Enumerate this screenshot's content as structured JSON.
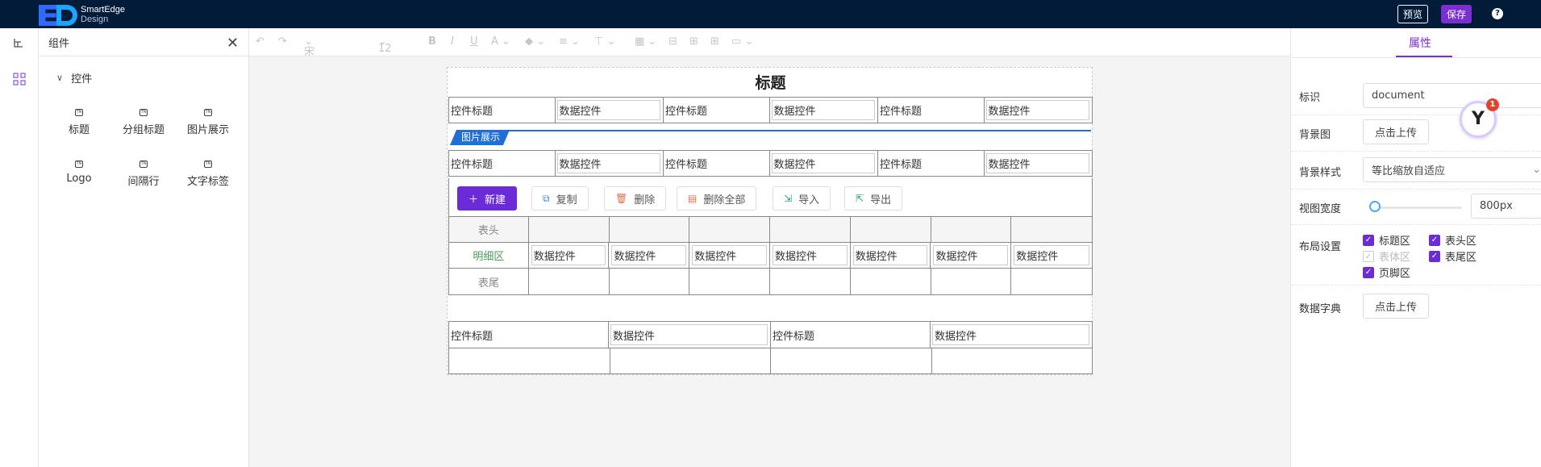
{
  "app": {
    "brand_line1": "SmartEdge",
    "brand_line2": "Design"
  },
  "header": {
    "preview_label": "预览",
    "save_label": "保存",
    "help_icon": "question-icon"
  },
  "left_panel": {
    "title": "组件",
    "group_title": "控件",
    "components": [
      {
        "label": "标题",
        "icon": "tn-icon"
      },
      {
        "label": "分组标题",
        "icon": "tn-icon"
      },
      {
        "label": "图片展示",
        "icon": "tn-icon"
      },
      {
        "label": "Logo",
        "icon": "tn-icon"
      },
      {
        "label": "间隔行",
        "icon": "tn-icon"
      },
      {
        "label": "文字标签",
        "icon": "tn-icon"
      }
    ]
  },
  "toolbar": {
    "font_family": "宋体",
    "font_size": "12"
  },
  "document": {
    "title": "标题",
    "row1": [
      "控件标题",
      "数据控件",
      "控件标题",
      "数据控件",
      "控件标题",
      "数据控件"
    ],
    "banner_label": "图片展示",
    "row2": [
      "控件标题",
      "数据控件",
      "控件标题",
      "数据控件",
      "控件标题",
      "数据控件"
    ],
    "actions": [
      {
        "label": "新建",
        "icon": "plus-icon"
      },
      {
        "label": "复制",
        "icon": "copy-icon"
      },
      {
        "label": "删除",
        "icon": "trash-icon"
      },
      {
        "label": "删除全部",
        "icon": "trash-all-icon"
      },
      {
        "label": "导入",
        "icon": "import-icon"
      },
      {
        "label": "导出",
        "icon": "export-icon"
      }
    ],
    "grid": {
      "header_label": "表头",
      "detail_label": "明细区",
      "footer_label": "表尾",
      "detail_cells": [
        "数据控件",
        "数据控件",
        "数据控件",
        "数据控件",
        "数据控件",
        "数据控件",
        "数据控件"
      ]
    },
    "footer_row": [
      "控件标题",
      "数据控件",
      "控件标题",
      "数据控件"
    ]
  },
  "properties": {
    "tab": "属性",
    "id_label": "标识",
    "id_value": "document",
    "bg_image_label": "背景图",
    "upload_label": "点击上传",
    "bg_style_label": "背景样式",
    "bg_style_value": "等比缩放自适应",
    "view_width_label": "视图宽度",
    "view_width_value": "800px",
    "layout_label": "布局设置",
    "layout_options": [
      {
        "label": "标题区",
        "checked": true,
        "disabled": false
      },
      {
        "label": "表头区",
        "checked": true,
        "disabled": false
      },
      {
        "label": "表体区",
        "checked": true,
        "disabled": true
      },
      {
        "label": "表尾区",
        "checked": true,
        "disabled": false
      },
      {
        "label": "页脚区",
        "checked": true,
        "disabled": false
      }
    ],
    "dict_label": "数据字典",
    "dict_upload_label": "点击上传"
  },
  "float_badge": {
    "count": "1"
  }
}
